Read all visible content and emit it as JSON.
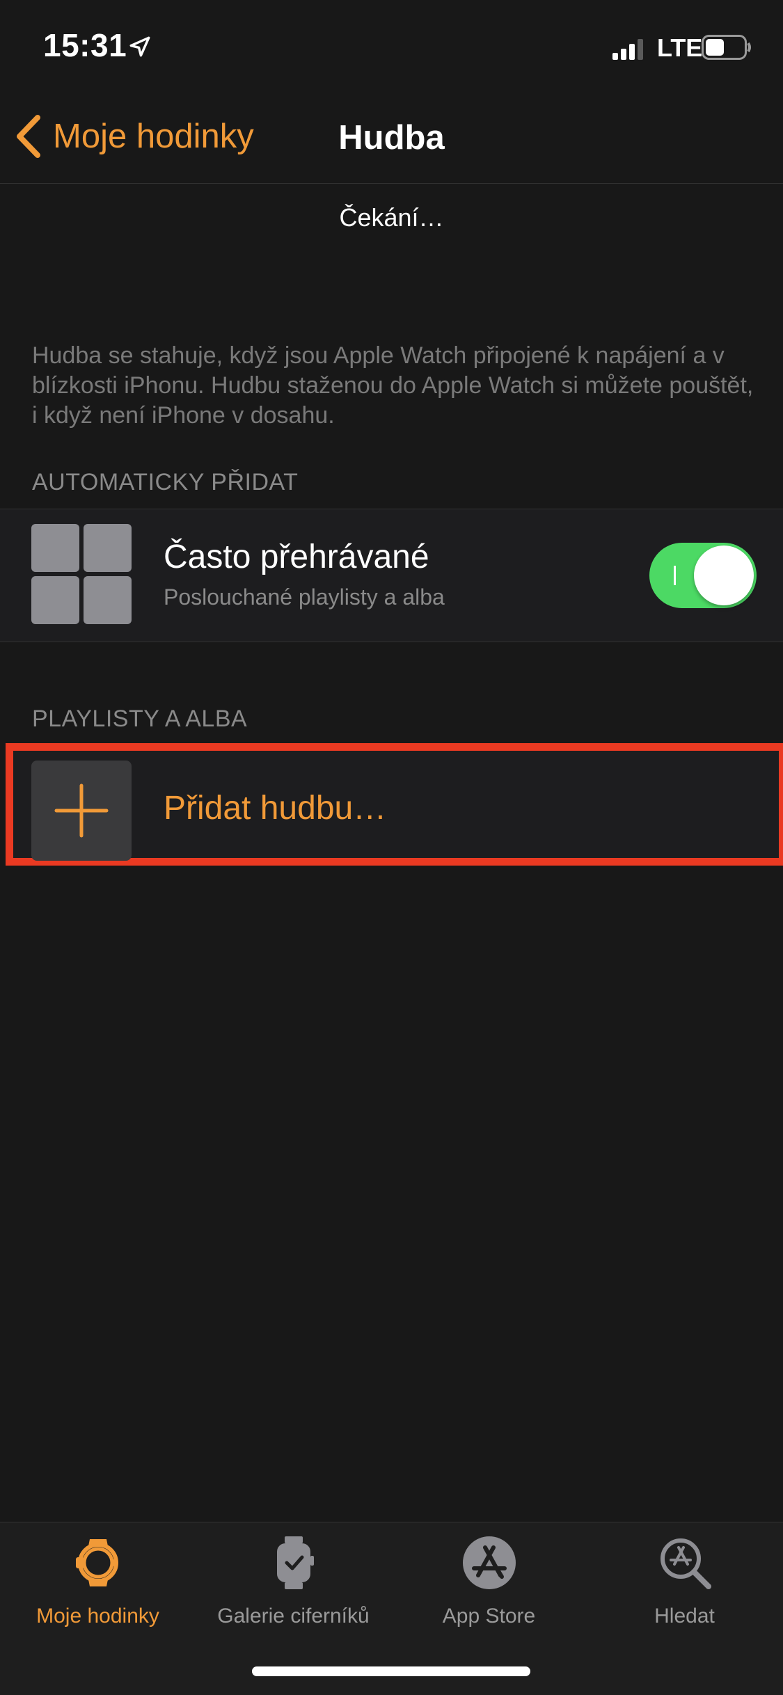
{
  "status_bar": {
    "time": "15:31",
    "network": "LTE",
    "icons": [
      "location-arrow-icon",
      "signal-icon",
      "battery-icon"
    ]
  },
  "nav": {
    "back_label": "Moje hodinky",
    "title": "Hudba"
  },
  "sync_status": "Čekání…",
  "info_text": "Hudba se stahuje, když jsou Apple Watch připojené k napájení a v blízkosti iPhonu. Hudbu staženou do Apple Watch si můžete pouštět, i když není iPhone v dosahu.",
  "auto_add": {
    "header": "AUTOMATICKY PŘIDAT",
    "item": {
      "title": "Často přehrávané",
      "subtitle": "Poslouchané playlisty a alba",
      "toggle_on": true
    }
  },
  "playlists": {
    "header": "PLAYLISTY A ALBA",
    "add_label": "Přidat hudbu…"
  },
  "tabs": [
    {
      "label": "Moje hodinky",
      "icon": "watch-icon",
      "active": true
    },
    {
      "label": "Galerie ciferníků",
      "icon": "watch-face-gallery-icon",
      "active": false
    },
    {
      "label": "App Store",
      "icon": "app-store-icon",
      "active": false
    },
    {
      "label": "Hledat",
      "icon": "search-icon",
      "active": false
    }
  ],
  "colors": {
    "accent": "#f19a38",
    "background": "#181818",
    "toggle_on": "#4cd964",
    "highlight_box": "#ea3a22"
  }
}
